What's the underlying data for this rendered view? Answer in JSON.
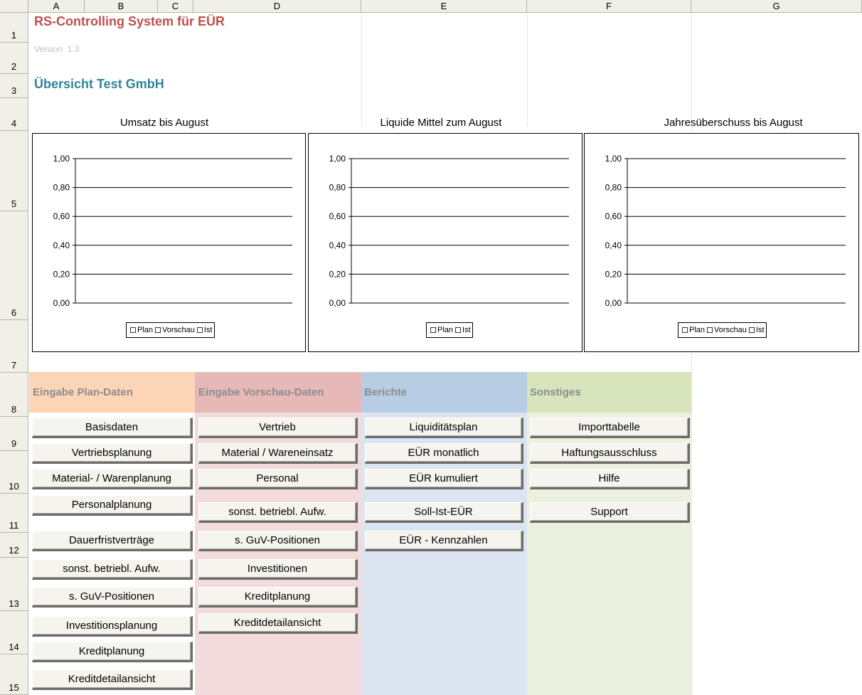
{
  "sheet": {
    "columns": [
      "A",
      "B",
      "C",
      "D",
      "E",
      "F",
      "G"
    ],
    "rows": [
      "1",
      "2",
      "3",
      "4",
      "5",
      "6",
      "7",
      "8",
      "9",
      "10",
      "11",
      "12",
      "13",
      "14",
      "15"
    ],
    "title": "RS-Controlling System für EÜR",
    "version_label": "Version",
    "version_number": "1.3",
    "subtitle": "Übersicht Test GmbH"
  },
  "colors": {
    "title": "#c0504d",
    "subtitle": "#31849b",
    "plan_band": "#fbd5b5",
    "vorschau_band": "#f2dcdb",
    "berichte_band": "#dbe5f1",
    "sonstiges_band": "#ebf1de"
  },
  "charts": [
    {
      "title": "Umsatz bis August",
      "y_ticks": [
        "1,00",
        "0,80",
        "0,60",
        "0,40",
        "0,20",
        "0,00"
      ],
      "legend": [
        "Plan",
        "Vorschau",
        "Ist"
      ]
    },
    {
      "title": "Liquide Mittel zum August",
      "y_ticks": [
        "1,00",
        "0,80",
        "0,60",
        "0,40",
        "0,20",
        "0,00"
      ],
      "legend": [
        "Plan",
        "Ist"
      ]
    },
    {
      "title": "Jahresüberschuss bis August",
      "y_ticks": [
        "1,00",
        "0,80",
        "0,60",
        "0,40",
        "0,20",
        "0,00"
      ],
      "legend": [
        "Plan",
        "Vorschau",
        "Ist"
      ]
    }
  ],
  "chart_data": [
    {
      "type": "bar",
      "title": "Umsatz bis August",
      "series": [
        {
          "name": "Plan",
          "values": []
        },
        {
          "name": "Vorschau",
          "values": []
        },
        {
          "name": "Ist",
          "values": []
        }
      ],
      "ylim": [
        0,
        1
      ],
      "grid": true,
      "legend": "bottom"
    },
    {
      "type": "bar",
      "title": "Liquide Mittel zum August",
      "series": [
        {
          "name": "Plan",
          "values": []
        },
        {
          "name": "Ist",
          "values": []
        }
      ],
      "ylim": [
        0,
        1
      ],
      "grid": true,
      "legend": "bottom"
    },
    {
      "type": "bar",
      "title": "Jahresüberschuss bis August",
      "series": [
        {
          "name": "Plan",
          "values": []
        },
        {
          "name": "Vorschau",
          "values": []
        },
        {
          "name": "Ist",
          "values": []
        }
      ],
      "ylim": [
        0,
        1
      ],
      "grid": true,
      "legend": "bottom"
    }
  ],
  "sections": {
    "plan": {
      "header": "Eingabe Plan-Daten",
      "buttons": [
        "Basisdaten",
        "Vertriebsplanung",
        "Material- / Warenplanung",
        "Personalplanung",
        "Dauerfristverträge",
        "sonst. betriebl. Aufw.",
        "s. GuV-Positionen",
        "Investitionsplanung",
        "Kreditplanung",
        "Kreditdetailansicht"
      ]
    },
    "vorschau": {
      "header": "Eingabe Vorschau-Daten",
      "buttons": [
        "Vertrieb",
        "Material / Wareneinsatz",
        "Personal",
        "sonst. betriebl. Aufw.",
        "s. GuV-Positionen",
        "Investitionen",
        "Kreditplanung",
        "Kreditdetailansicht"
      ]
    },
    "berichte": {
      "header": "Berichte",
      "buttons": [
        "Liquiditätsplan",
        "EÜR monatlich",
        "EÜR kumuliert",
        "Soll-Ist-EÜR",
        "EÜR - Kennzahlen"
      ]
    },
    "sonstiges": {
      "header": "Sonstiges",
      "buttons": [
        "Importtabelle",
        "Haftungsausschluss",
        "Hilfe",
        "Support"
      ]
    }
  }
}
